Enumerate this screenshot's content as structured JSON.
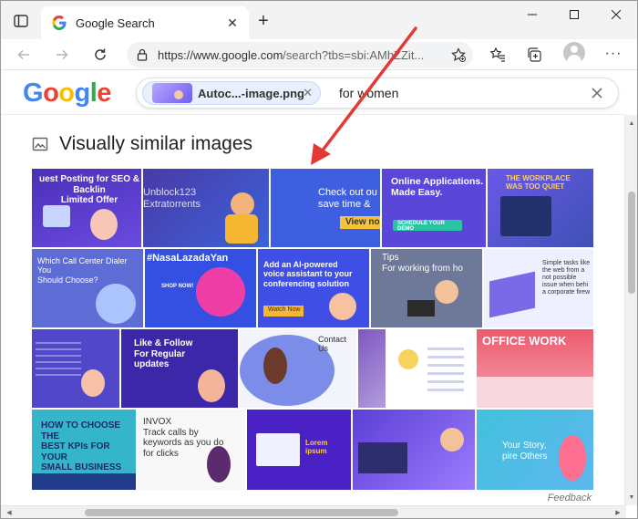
{
  "browser": {
    "tab_title": "Google Search",
    "url_host": "https://www.google.com",
    "url_rest": "/search?tbs=sbi:AMhZZit...",
    "new_tab_symbol": "+",
    "more_symbol": "···",
    "tab_close_symbol": "✕"
  },
  "google": {
    "logo_letters": [
      "G",
      "o",
      "o",
      "g",
      "l",
      "e"
    ],
    "image_chip_label": "Autoc...-image.png",
    "chip_close": "✕",
    "query": "for women"
  },
  "section": {
    "title": "Visually similar images"
  },
  "tiles": [
    {
      "text": "uest Posting for SEO & Backlin\nLimited Offer"
    },
    {
      "text": "Unblock123\nExtratorrents"
    },
    {
      "text": "Check out ou\nsave time &"
    },
    {
      "text": "Online Applications.\nMade Easy."
    },
    {
      "text": "THE WORKPLACE\nWAS TOO QUIET"
    },
    {
      "text": "Which Call Center Dialer You\nShould Choose?"
    },
    {
      "text": "#NasaLazadaYan"
    },
    {
      "text": "Add an AI-powered\nvoice assistant to your\nconferencing solution"
    },
    {
      "text": "Tips\nFor working from ho"
    },
    {
      "text": "Simple tasks like\nthe web from a\nnot possible\nissue when behi\na corporate firew"
    },
    {
      "text": "Like & Follow\nFor Regular\nupdates"
    },
    {
      "text": "Contact Us"
    },
    {
      "text": "OFFICE WORK"
    },
    {
      "text": "HOW TO CHOOSE THE\nBEST KPIs FOR YOUR\nSMALL BUSINESS"
    },
    {
      "text": "INVOX\nTrack calls by\nkeywords as you do\nfor clicks"
    },
    {
      "text": "Lorem ipsum"
    },
    {
      "text": "Your Story,\npire Others"
    }
  ],
  "view_now": "View no",
  "shop_now": "SHOP NOW!",
  "watch_now": "Watch Now",
  "schedule_demo": "SCHEDULE YOUR DEMO",
  "footer": {
    "feedback": "Feedback"
  },
  "colors": {
    "arrow": "#e53935",
    "accent": "#1a73e8"
  }
}
